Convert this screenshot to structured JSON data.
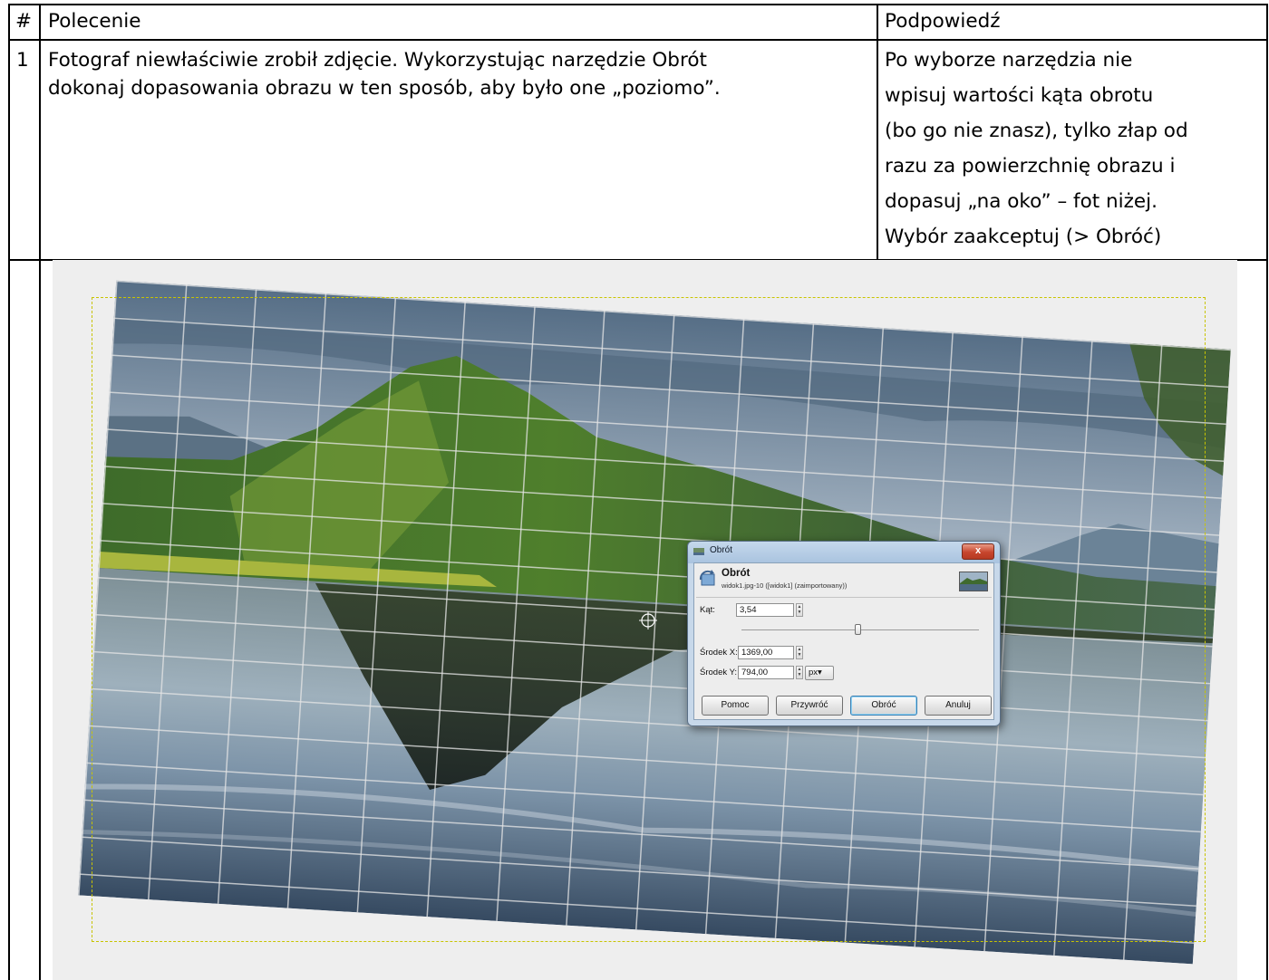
{
  "table": {
    "headers": {
      "num": "#",
      "task": "Polecenie",
      "hint": "Podpowiedź"
    },
    "row1": {
      "num": "1",
      "task_lines": [
        "Fotograf niewłaściwie zrobił zdjęcie. Wykorzystując narzędzie Obrót",
        "dokonaj dopasowania obrazu w ten sposób, aby było one „poziomo”."
      ],
      "hint_lines": [
        "Po wyborze narzędzia nie",
        "wpisuj wartości kąta obrotu",
        "(bo go nie znasz), tylko złap od",
        "razu za powierzchnię obrazu i",
        "dopasuj „na oko” – fot niżej.",
        "Wybór zaakceptuj (> Obróć)"
      ]
    }
  },
  "dialog": {
    "window_title": "Obrót",
    "close_label": "x",
    "heading": "Obrót",
    "subheading": "widok1.jpg-10 ([widok1] (zaimportowany))",
    "angle": {
      "label": "Kąt:",
      "value": "3,54",
      "slider_fraction": 0.49
    },
    "center_x": {
      "label": "Środek X:",
      "value": "1369,00"
    },
    "center_y": {
      "label": "Środek Y:",
      "value": "794,00"
    },
    "unit": {
      "value": "px",
      "arrow": "▾"
    },
    "buttons": {
      "help": "Pomoc",
      "reset": "Przywróć",
      "rotate": "Obróć",
      "cancel": "Anuluj"
    }
  },
  "icons": [
    "rotate-tool-icon",
    "image-thumbnail-icon",
    "window-icon",
    "close-icon",
    "pivot-crosshair-icon"
  ],
  "colors": {
    "canvas_bg": "#eeeeee",
    "grid_line": "#e6e6e6",
    "selection_marquee": "#c8c400",
    "close_button": "#c7452d",
    "default_button_border": "#3c7fb1"
  }
}
